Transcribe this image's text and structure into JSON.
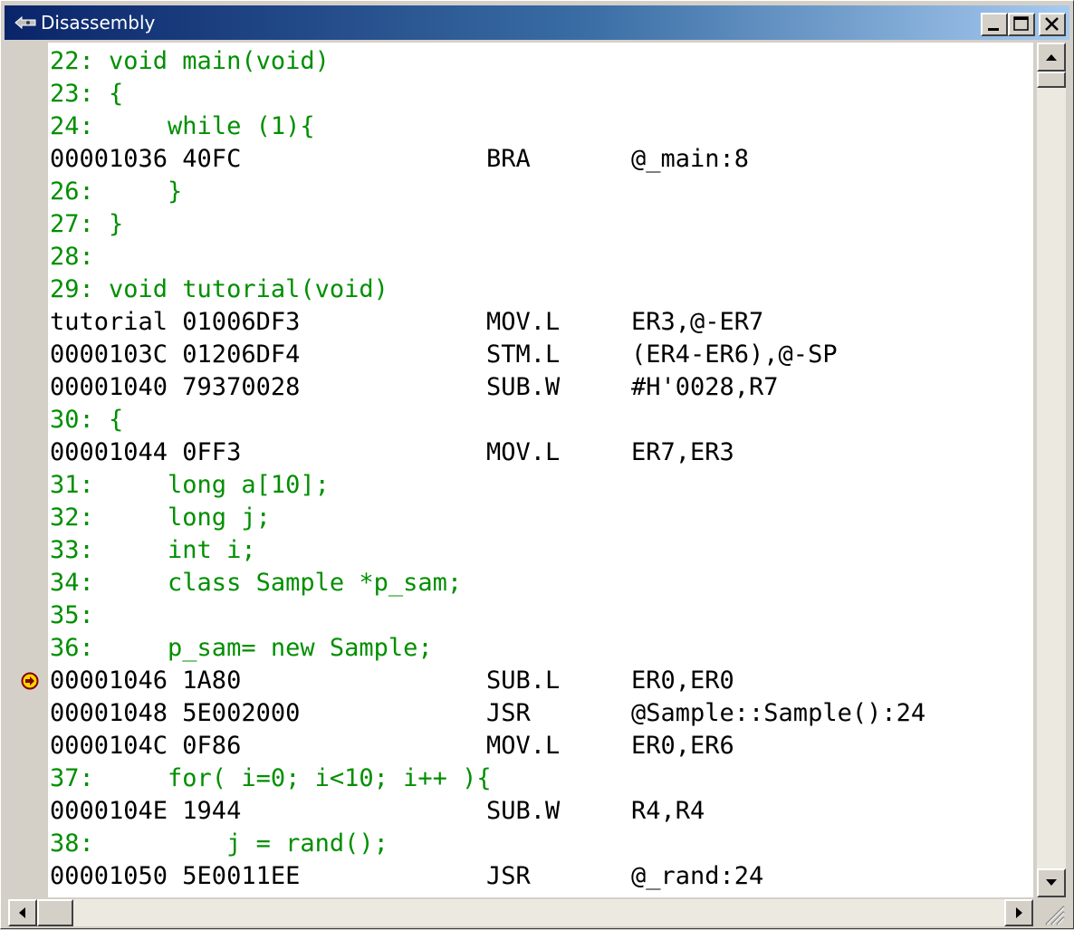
{
  "window": {
    "title": "Disassembly",
    "icon": "disassembly-icon"
  },
  "colors": {
    "source_text": "#008f00",
    "asm_text": "#000000",
    "title_bar": "#0a246a",
    "breakpoint": "#ffd800"
  },
  "lines": [
    {
      "type": "src",
      "text": "22: void main(void)"
    },
    {
      "type": "src",
      "text": "23: {"
    },
    {
      "type": "src",
      "text": "24:     while (1){"
    },
    {
      "type": "asm",
      "addr": "00001036 40FC",
      "op": "BRA",
      "args": "@_main:8"
    },
    {
      "type": "src",
      "text": "26:     }"
    },
    {
      "type": "src",
      "text": "27: }"
    },
    {
      "type": "src",
      "text": "28:"
    },
    {
      "type": "src",
      "text": "29: void tutorial(void)"
    },
    {
      "type": "asm",
      "addr": "tutorial 01006DF3",
      "op": "MOV.L",
      "args": "ER3,@-ER7"
    },
    {
      "type": "asm",
      "addr": "0000103C 01206DF4",
      "op": "STM.L",
      "args": "(ER4-ER6),@-SP"
    },
    {
      "type": "asm",
      "addr": "00001040 79370028",
      "op": "SUB.W",
      "args": "#H'0028,R7"
    },
    {
      "type": "src",
      "text": "30: {"
    },
    {
      "type": "asm",
      "addr": "00001044 0FF3",
      "op": "MOV.L",
      "args": "ER7,ER3"
    },
    {
      "type": "src",
      "text": "31:     long a[10];"
    },
    {
      "type": "src",
      "text": "32:     long j;"
    },
    {
      "type": "src",
      "text": "33:     int i;"
    },
    {
      "type": "src",
      "text": "34:     class Sample *p_sam;"
    },
    {
      "type": "src",
      "text": "35:"
    },
    {
      "type": "src",
      "text": "36:     p_sam= new Sample;"
    },
    {
      "type": "asm",
      "addr": "00001046 1A80",
      "op": "SUB.L",
      "args": "ER0,ER0",
      "current": true
    },
    {
      "type": "asm",
      "addr": "00001048 5E002000",
      "op": "JSR",
      "args": "@Sample::Sample():24"
    },
    {
      "type": "asm",
      "addr": "0000104C 0F86",
      "op": "MOV.L",
      "args": "ER0,ER6"
    },
    {
      "type": "src",
      "text": "37:     for( i=0; i<10; i++ ){"
    },
    {
      "type": "asm",
      "addr": "0000104E 1944",
      "op": "SUB.W",
      "args": "R4,R4"
    },
    {
      "type": "src",
      "text": "38:         j = rand();"
    },
    {
      "type": "asm",
      "addr": "00001050 5E0011EE",
      "op": "JSR",
      "args": "@_rand:24"
    }
  ],
  "controls": {
    "minimize_icon": "minimize-icon",
    "maximize_icon": "maximize-icon",
    "close_icon": "close-icon",
    "scroll_up_icon": "arrow-up-icon",
    "scroll_down_icon": "arrow-down-icon",
    "scroll_left_icon": "arrow-left-icon",
    "scroll_right_icon": "arrow-right-icon"
  }
}
